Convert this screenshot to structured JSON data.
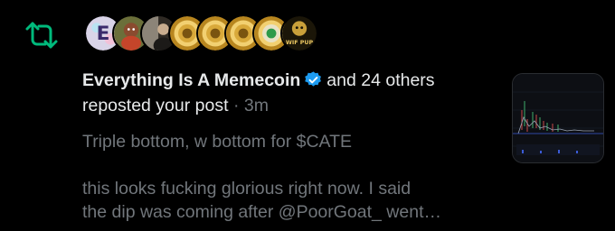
{
  "notification": {
    "type_icon": "repost-icon",
    "accent_color": "#00ba7c",
    "actor_name": "Everything Is A Memecoin",
    "actor_verified": true,
    "others": "and 24 others",
    "action": "reposted your post",
    "separator": "·",
    "time": "3m",
    "avatars": [
      {
        "icon": "letter-e-avatar",
        "text": "E"
      },
      {
        "icon": "cartoon-character-avatar"
      },
      {
        "icon": "person-photo-avatar"
      },
      {
        "icon": "gold-coin-avatar"
      },
      {
        "icon": "gold-coin-avatar"
      },
      {
        "icon": "gold-coin-avatar"
      },
      {
        "icon": "gold-coin-green-avatar"
      },
      {
        "icon": "wiw-pup-avatar",
        "text": "WIF PUP"
      }
    ]
  },
  "post": {
    "line1": "Triple bottom, w bottom for $CATE",
    "line2": "this looks fucking glorious right now. I said",
    "line3": "the dip was coming after @PoorGoat_ went…"
  },
  "thumbnail": {
    "icon": "price-chart-thumbnail"
  }
}
